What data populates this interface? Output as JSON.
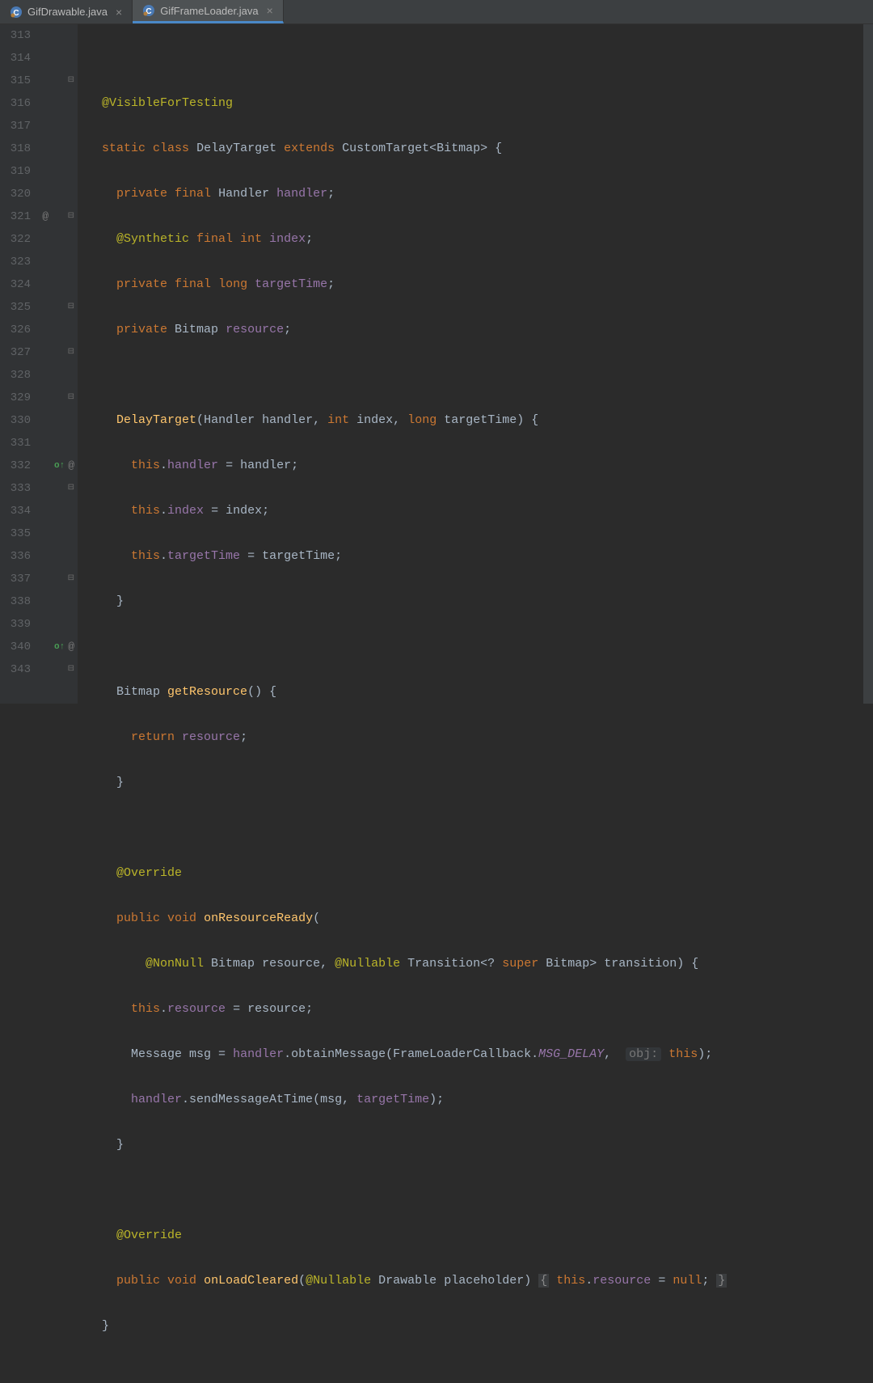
{
  "tabs": [
    {
      "label": "GifDrawable.java",
      "active": false
    },
    {
      "label": "GifFrameLoader.java",
      "active": true
    }
  ],
  "gutter_lines": [
    "313",
    "314",
    "315",
    "316",
    "317",
    "318",
    "319",
    "320",
    "321",
    "322",
    "323",
    "324",
    "325",
    "326",
    "327",
    "328",
    "329",
    "330",
    "331",
    "332",
    "333",
    "334",
    "335",
    "336",
    "337",
    "338",
    "339",
    "340",
    "343"
  ],
  "annotations": {
    "321": {
      "symbols": [
        "@"
      ],
      "fold": "open"
    },
    "315": {
      "fold": "open"
    },
    "325": {
      "fold": "close"
    },
    "327": {
      "fold": "open"
    },
    "329": {
      "fold": "close"
    },
    "332": {
      "symbols": [
        "o",
        "@"
      ]
    },
    "333": {
      "fold": "open"
    },
    "337": {
      "fold": "close"
    },
    "340": {
      "symbols": [
        "o",
        "@"
      ]
    },
    "343": {
      "fold": "close"
    }
  },
  "code": {
    "l314": {
      "ann": "@VisibleForTesting"
    },
    "l315": {
      "kw1": "static",
      "kw2": "class",
      "name": "DelayTarget",
      "kw3": "extends",
      "sup": "CustomTarget<Bitmap> {"
    },
    "l316": {
      "kw1": "private",
      "kw2": "final",
      "type": "Handler",
      "field": "handler",
      "end": ";"
    },
    "l317": {
      "ann": "@Synthetic",
      "kw2": "final",
      "kw3": "int",
      "field": "index",
      "end": ";"
    },
    "l318": {
      "kw1": "private",
      "kw2": "final",
      "kw3": "long",
      "field": "targetTime",
      "end": ";"
    },
    "l319": {
      "kw1": "private",
      "type": "Bitmap",
      "field": "resource",
      "end": ";"
    },
    "l321": {
      "name": "DelayTarget",
      "p1t": "Handler",
      "p1n": "handler",
      "p2t": "int",
      "p2n": "index",
      "p3t": "long",
      "p3n": "targetTime",
      "end": ") {"
    },
    "l322": {
      "kw": "this",
      "field": "handler",
      "eq": " = handler;"
    },
    "l323": {
      "kw": "this",
      "field": "index",
      "eq": " = index;"
    },
    "l324": {
      "kw": "this",
      "field": "targetTime",
      "eq": " = targetTime;"
    },
    "l325": {
      "text": "}"
    },
    "l327": {
      "type": "Bitmap",
      "fn": "getResource",
      "end": "() {"
    },
    "l328": {
      "kw": "return",
      "field": "resource",
      "end": ";"
    },
    "l329": {
      "text": "}"
    },
    "l331": {
      "ann": "@Override"
    },
    "l332": {
      "kw1": "public",
      "kw2": "void",
      "fn": "onResourceReady",
      "end": "("
    },
    "l333": {
      "ann1": "@NonNull",
      "t1": "Bitmap",
      "n1": "resource",
      "ann2": "@Nullable",
      "t2": "Transition<?",
      "kw": "super",
      "t3": "Bitmap>",
      "n2": "transition",
      "end": ") {"
    },
    "l334": {
      "kw": "this",
      "field": "resource",
      "eq": " = resource;"
    },
    "l335": {
      "t1": "Message",
      "n1": "msg = ",
      "field": "handler",
      "fn": ".obtainMessage",
      "p1": "(FrameLoaderCallback.",
      "const": "MSG_DELAY",
      "hint": "obj:",
      "kw": "this",
      "end": ");"
    },
    "l336": {
      "field": "handler",
      "fn": ".sendMessageAtTime",
      "p": "(msg,",
      "field2": "targetTime",
      "end": ");"
    },
    "l337": {
      "text": "}"
    },
    "l339": {
      "ann": "@Override"
    },
    "l340": {
      "kw1": "public",
      "kw2": "void",
      "fn": "onLoadCleared",
      "ann": "@Nullable",
      "t": "Drawable",
      "n": "placeholder)",
      "brace1": "{",
      "kw3": "this",
      "field": "resource",
      "eq": " = ",
      "kw4": "null",
      "end": ";",
      "brace2": "}"
    },
    "l343": {
      "text": "}"
    }
  }
}
